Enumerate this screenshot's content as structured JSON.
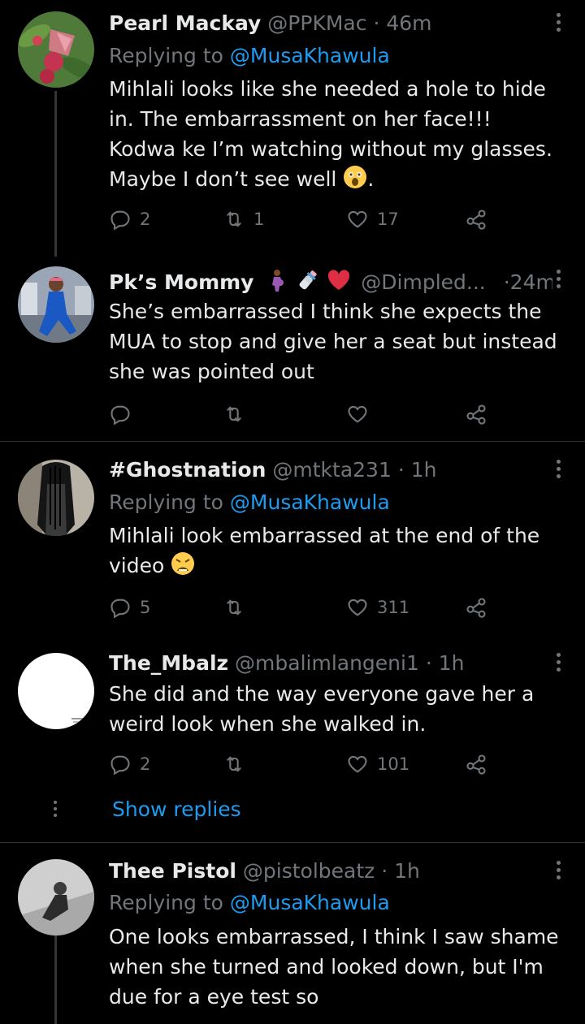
{
  "tweets": [
    {
      "name": "Pearl Mackay",
      "handle": "@PPKMac",
      "time": "46m",
      "replying_label": "Replying to",
      "replying_to": "@MusaKhawula",
      "text": "Mihlali looks like she needed a hole to hide in. The embarrassment on her face!!! Kodwa ke I’m watching without my glasses. Maybe I don’t see well",
      "text_suffix": ".",
      "emoji": "astonished-face",
      "replies": "2",
      "retweets": "1",
      "likes": "17"
    },
    {
      "name": "Pk’s Mommy",
      "name_emojis": [
        "pregnant-woman",
        "baby-bottle",
        "red-heart"
      ],
      "handle": "@Dimpled...",
      "time": "24m",
      "text": "She’s embarrassed I think she expects the MUA to stop and give her a seat but instead she was pointed out",
      "replies": "",
      "retweets": "",
      "likes": ""
    },
    {
      "name": "#Ghostnation",
      "handle": "@mtkta231",
      "time": "1h",
      "replying_label": "Replying to",
      "replying_to": "@MusaKhawula",
      "text": "Mihlali look embarrassed at the end of the video",
      "emoji": "weary-face",
      "replies": "5",
      "retweets": "",
      "likes": "311"
    },
    {
      "name": "The_Mbalz",
      "handle": "@mbalimlangeni1",
      "time": "1h",
      "text": "She did and the way everyone gave her a weird look when she walked in.",
      "replies": "2",
      "retweets": "",
      "likes": "101"
    },
    {
      "name": "Thee Pistol",
      "handle": "@pistolbeatz",
      "time": "1h",
      "replying_label": "Replying to",
      "replying_to": "@MusaKhawula",
      "text": "One looks embarrassed, I think I saw shame when she turned and looked down, but I'm due for a eye test so"
    }
  ],
  "show_replies": "Show replies",
  "dot_sep": "·",
  "colors": {
    "background": "#000000",
    "text": "#e7e9ea",
    "muted": "#71767b",
    "link": "#1d9bf0",
    "separator": "#2f3336"
  },
  "icons": [
    "reply-icon",
    "retweet-icon",
    "like-icon",
    "share-icon",
    "more-icon"
  ]
}
